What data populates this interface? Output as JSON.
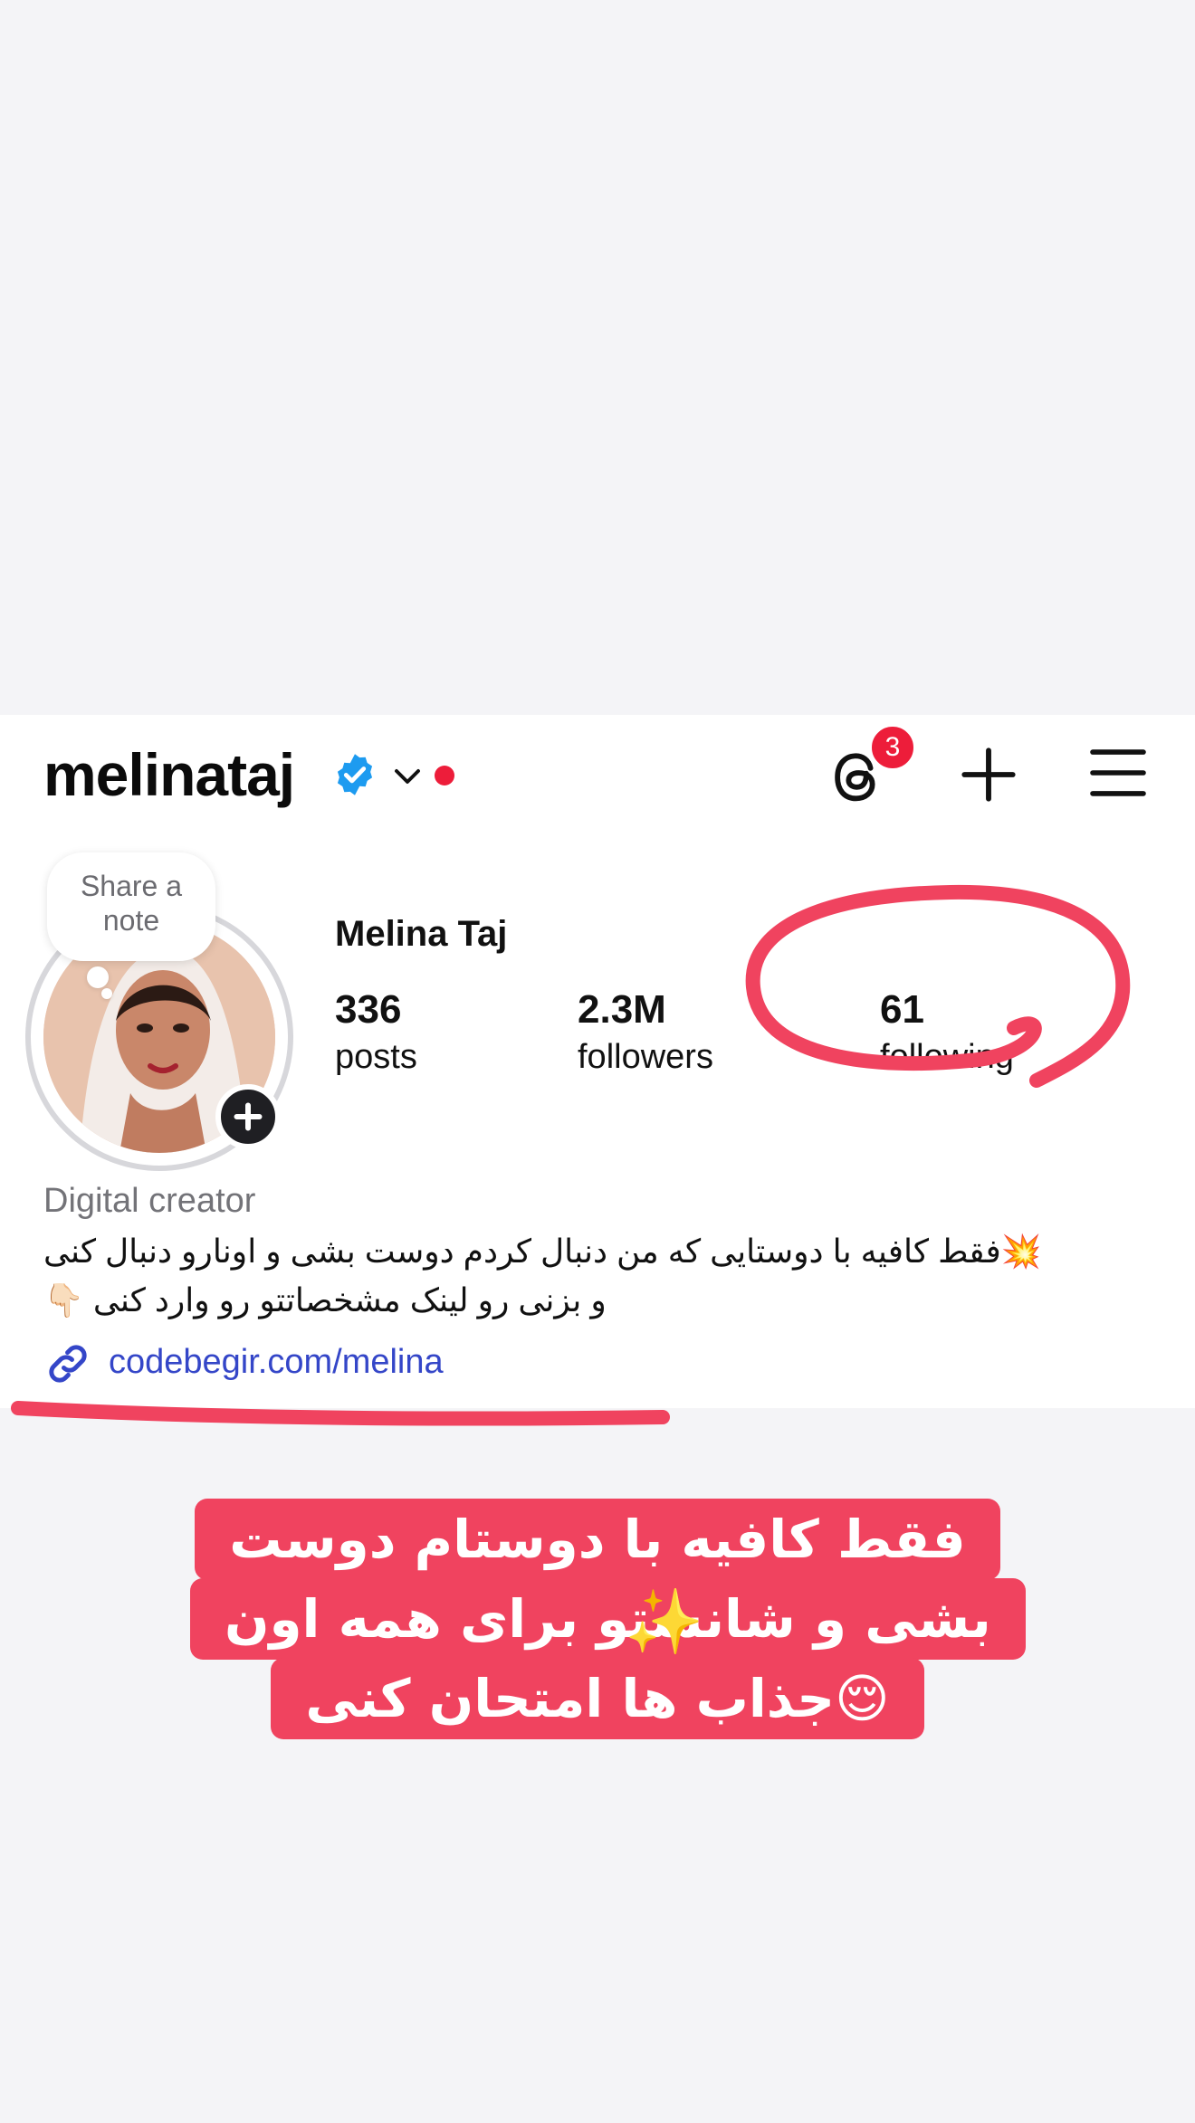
{
  "header": {
    "username": "melinataj",
    "threads_badge_count": "3",
    "icons": [
      "verified-badge-icon",
      "chevron-down-icon",
      "threads-icon",
      "plus-icon",
      "menu-icon"
    ]
  },
  "profile": {
    "note_placeholder": "Share a note",
    "full_name": "Melina Taj",
    "stats": [
      {
        "value": "336",
        "label": "posts"
      },
      {
        "value": "2.3M",
        "label": "followers"
      },
      {
        "value": "61",
        "label": "following"
      }
    ],
    "category": "Digital creator",
    "bio_line1": "💥فقط کافیه با دوستایی که من دنبال کردم دوست بشی و اونارو دنبال کنی",
    "bio_line2": "و بزنی رو لینک مشخصاتتو رو وارد کنی 👇🏻",
    "link": "codebegir.com/melina"
  },
  "overlay_caption": {
    "line1": "فقط کافیه با دوستام دوست",
    "line2": "بشی و شانستو برای همه اون",
    "line3": "جذاب ها امتحان کنی",
    "emoji": "😌",
    "sparkles": "✨"
  },
  "colors": {
    "accent_red": "#ed1d3a",
    "annotation_pink": "#f0435f",
    "link_blue": "#3446c8",
    "verified_blue": "#1d9bf0"
  }
}
